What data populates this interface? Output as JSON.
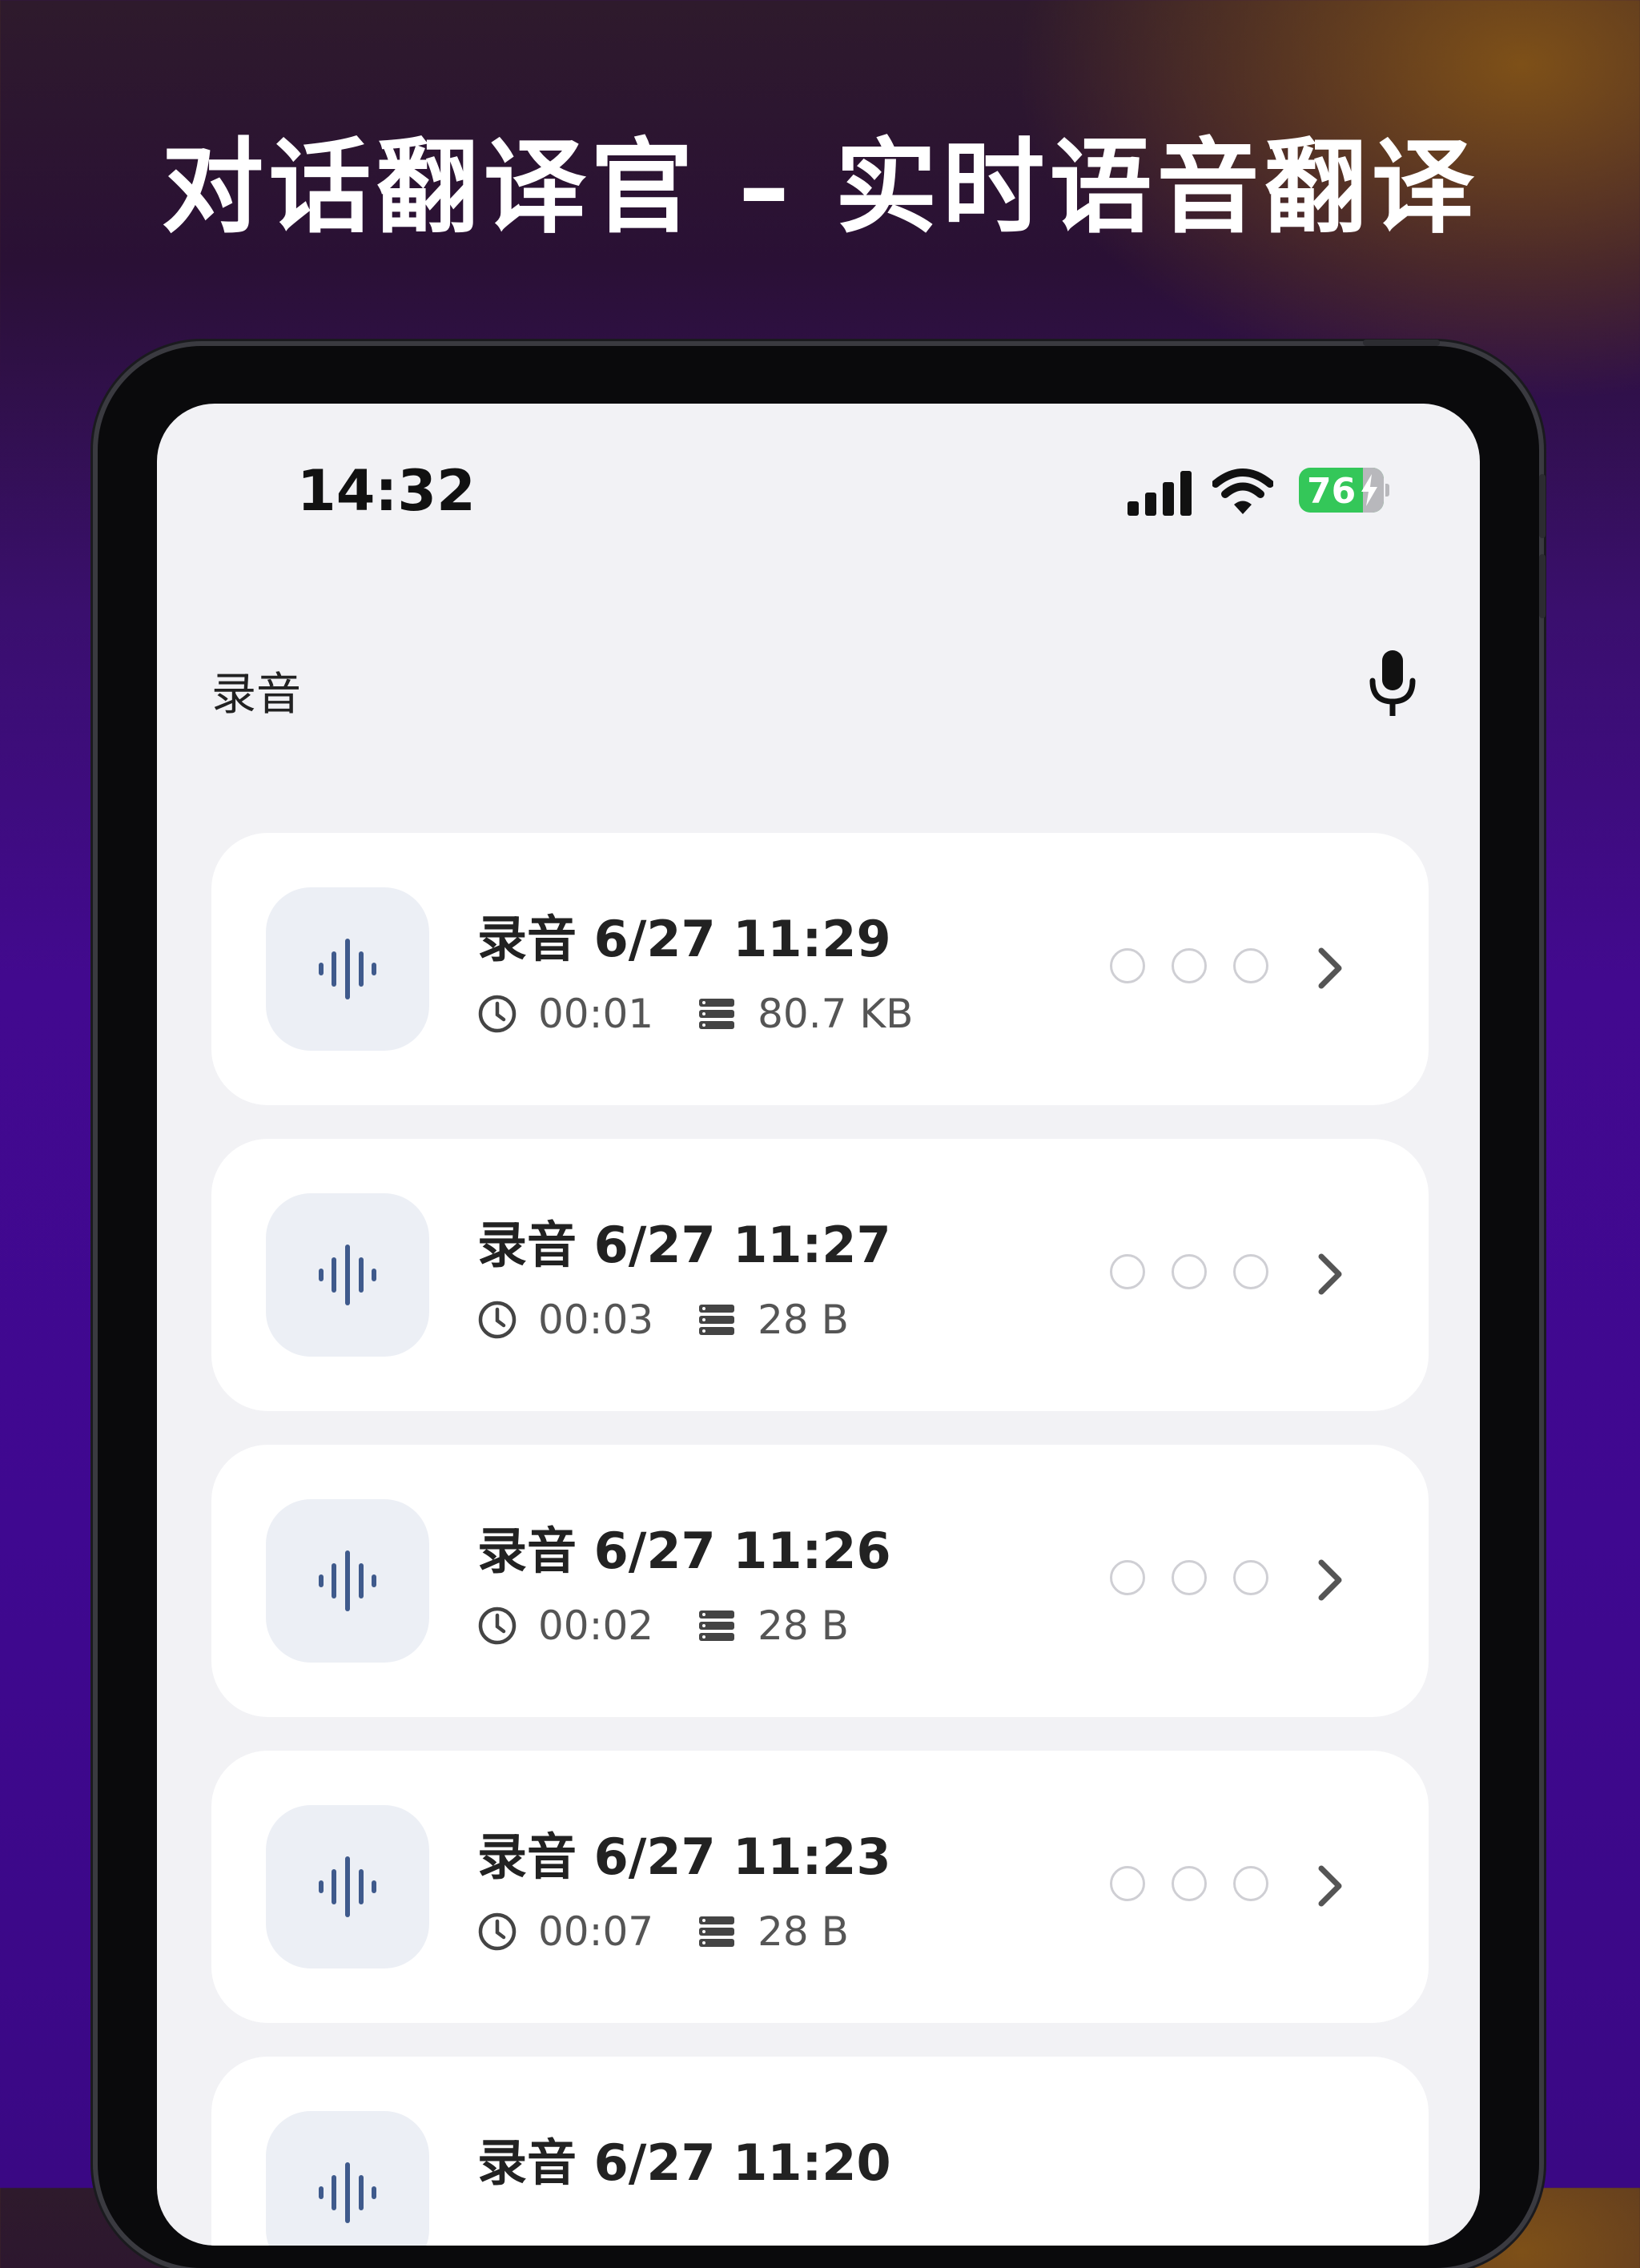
{
  "promo": {
    "headline": "对话翻译官 – 实时语音翻译"
  },
  "status_bar": {
    "time": "14:32",
    "battery_level": "76",
    "icons": [
      "cellular-signal-icon",
      "wifi-icon",
      "battery-charging-icon"
    ]
  },
  "nav": {
    "title": "录音",
    "action_icon": "microphone-icon"
  },
  "recordings": [
    {
      "title": "录音 6/27 11:29",
      "duration": "00:01",
      "size": "80.7 KB"
    },
    {
      "title": "录音 6/27 11:27",
      "duration": "00:03",
      "size": "28 B"
    },
    {
      "title": "录音 6/27 11:26",
      "duration": "00:02",
      "size": "28 B"
    },
    {
      "title": "录音 6/27 11:23",
      "duration": "00:07",
      "size": "28 B"
    },
    {
      "title": "录音 6/27 11:20",
      "duration": "",
      "size": ""
    }
  ],
  "colors": {
    "waveform": "#3f5a8c",
    "battery": "#34c759",
    "card_background": "#ffffff",
    "screen_background": "#f2f2f5"
  }
}
